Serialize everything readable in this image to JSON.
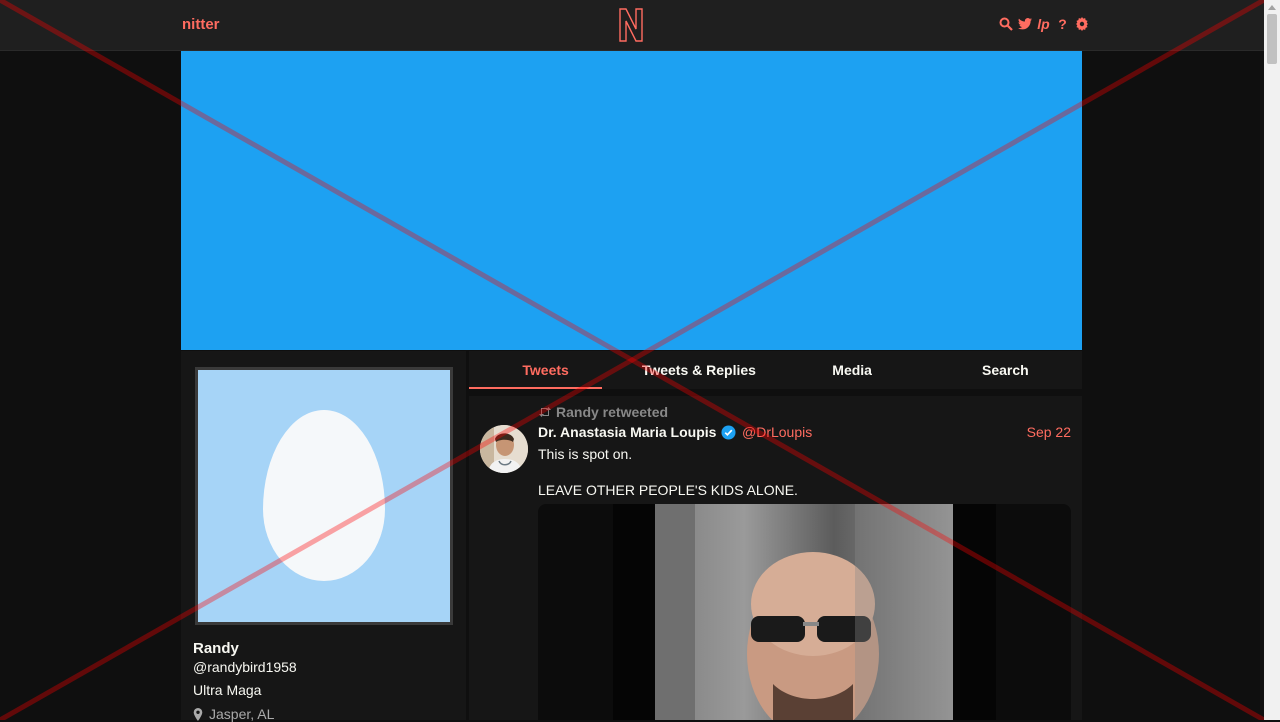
{
  "nav": {
    "brand": "nitter",
    "icons": [
      "search-icon",
      "twitter-bird-icon",
      "lp-icon",
      "help-icon",
      "gear-icon"
    ],
    "lp_label": "lp",
    "help_label": "?"
  },
  "colors": {
    "accent": "#ff6c60",
    "banner": "#1da1f2",
    "avatar_bg": "#a6d4f7",
    "background": "#0f0f0f",
    "panel": "#161616"
  },
  "profile": {
    "fullname": "Randy",
    "username": "@randybird1958",
    "bio": "Ultra Maga",
    "location": "Jasper, AL"
  },
  "tabs": [
    {
      "label": "Tweets",
      "active": true
    },
    {
      "label": "Tweets & Replies",
      "active": false
    },
    {
      "label": "Media",
      "active": false
    },
    {
      "label": "Search",
      "active": false
    }
  ],
  "tweet": {
    "retweet_header": "Randy retweeted",
    "fullname": "Dr. Anastasia Maria Loupis",
    "username": "@DrLoupis",
    "date": "Sep 22",
    "verified": true,
    "text_lines": [
      "This is spot on.",
      "LEAVE OTHER PEOPLE'S KIDS ALONE."
    ]
  }
}
